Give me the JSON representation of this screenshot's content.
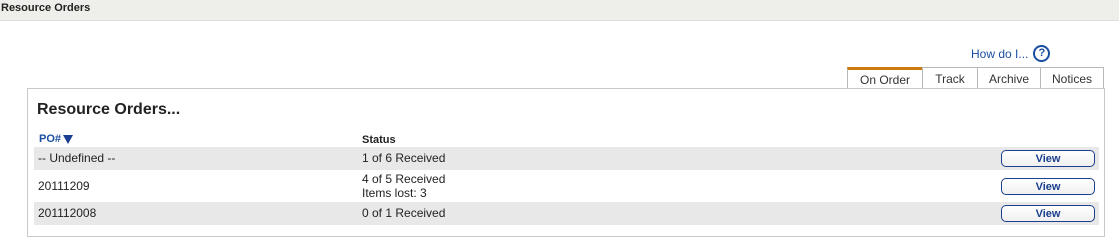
{
  "header": {
    "title": "Resource Orders"
  },
  "help": {
    "label": "How do I...",
    "icon": "help-circle-icon"
  },
  "tabs": [
    {
      "label": "On Order",
      "active": true
    },
    {
      "label": "Track",
      "active": false
    },
    {
      "label": "Archive",
      "active": false
    },
    {
      "label": "Notices",
      "active": false
    }
  ],
  "panel": {
    "title": "Resource Orders...",
    "columns": {
      "po": "PO#",
      "status": "Status"
    },
    "sort": {
      "column": "PO#",
      "direction": "descending"
    },
    "rows": [
      {
        "po": "-- Undefined --",
        "status": "1 of 6 Received",
        "status_extra": "",
        "action": "View"
      },
      {
        "po": "20111209",
        "status": "4 of 5 Received",
        "status_extra": "Items lost: 3",
        "action": "View"
      },
      {
        "po": "201112008",
        "status": "0 of 1 Received",
        "status_extra": "",
        "action": "View"
      }
    ]
  },
  "colors": {
    "link": "#1a4fa0",
    "active_tab_accent": "#cc7a10",
    "row_shade": "#e8e8e8",
    "topbar_bg": "#eeeeea"
  }
}
